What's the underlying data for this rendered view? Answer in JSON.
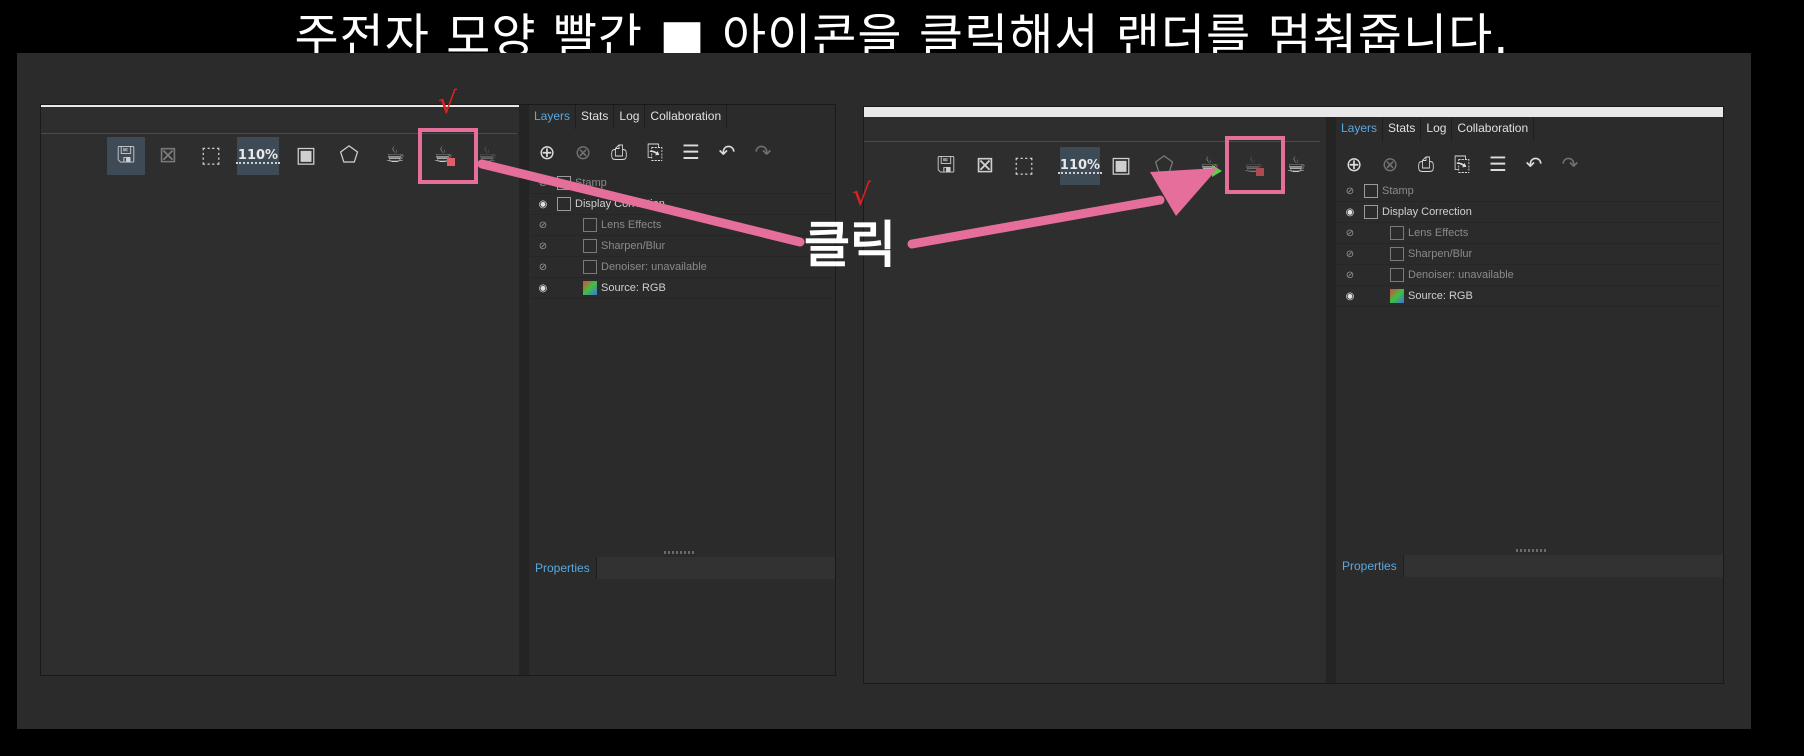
{
  "caption": "주전자 모양 빨간 ■ 아이콘을 클릭해서 랜더를 멈춰줍니다.",
  "click_label": "클릭",
  "check_mark": "√",
  "accent_color": "#e56f9a",
  "tab_active_color": "#5aa8e0",
  "panels": {
    "tabs": [
      "Layers",
      "Stats",
      "Log",
      "Collaboration"
    ],
    "properties_label": "Properties",
    "layers": [
      {
        "name": "Stamp",
        "visible": false,
        "level": 0
      },
      {
        "name": "Display Correction",
        "visible": true,
        "level": 0
      },
      {
        "name": "Lens Effects",
        "visible": false,
        "level": 1
      },
      {
        "name": "Sharpen/Blur",
        "visible": false,
        "level": 1
      },
      {
        "name": "Denoiser: unavailable",
        "visible": false,
        "level": 1
      },
      {
        "name": "Source: RGB",
        "visible": true,
        "level": 1
      }
    ]
  },
  "toolbar": {
    "zoom": "110%",
    "icons": [
      "save-icon",
      "clear-icon",
      "region-select-icon",
      "zoom-icon",
      "frame-icon",
      "select-object-icon",
      "teapot-render-icon",
      "teapot-stop-render-icon",
      "teapot-icon"
    ]
  },
  "layer_tools": [
    "add-layer-icon",
    "remove-layer-icon",
    "save-layer-icon",
    "load-layer-icon",
    "list-icon",
    "undo-icon",
    "redo-icon"
  ],
  "icons": {
    "eye": "◉",
    "eye_off": "⊘"
  }
}
